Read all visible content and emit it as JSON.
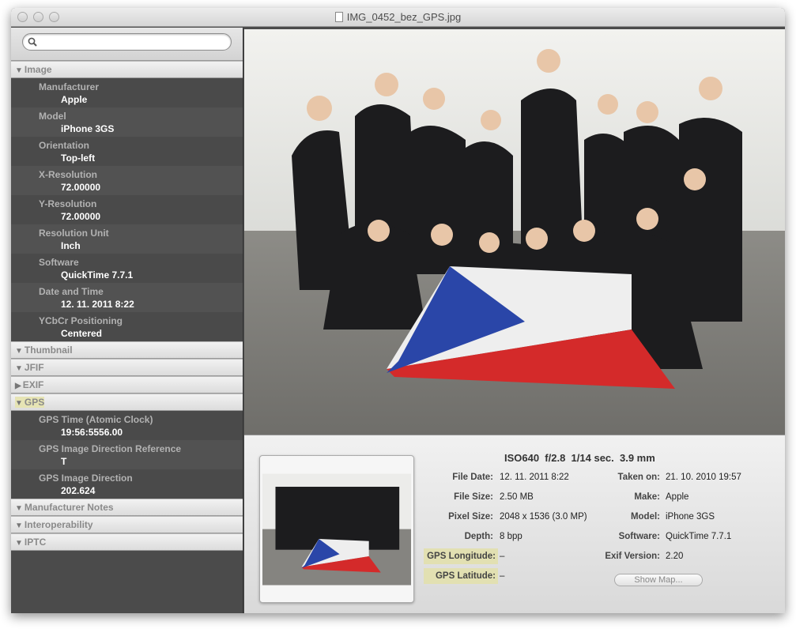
{
  "window": {
    "title": "IMG_0452_bez_GPS.jpg"
  },
  "search": {
    "placeholder": ""
  },
  "sections": [
    {
      "label": "Image",
      "expanded": true,
      "rows": [
        {
          "k": "Manufacturer",
          "v": "Apple"
        },
        {
          "k": "Model",
          "v": "iPhone 3GS"
        },
        {
          "k": "Orientation",
          "v": "Top-left"
        },
        {
          "k": "X-Resolution",
          "v": "72.00000"
        },
        {
          "k": "Y-Resolution",
          "v": "72.00000"
        },
        {
          "k": "Resolution Unit",
          "v": "Inch"
        },
        {
          "k": "Software",
          "v": "QuickTime 7.7.1"
        },
        {
          "k": "Date and Time",
          "v": "12. 11. 2011 8:22"
        },
        {
          "k": "YCbCr Positioning",
          "v": "Centered"
        }
      ]
    },
    {
      "label": "Thumbnail",
      "expanded": true,
      "rows": []
    },
    {
      "label": "JFIF",
      "expanded": true,
      "rows": []
    },
    {
      "label": "EXIF",
      "expanded": false,
      "rows": []
    },
    {
      "label": "GPS",
      "expanded": true,
      "highlight": true,
      "rows": [
        {
          "k": "GPS Time (Atomic Clock)",
          "v": "19:56:5556.00"
        },
        {
          "k": "GPS Image Direction Reference",
          "v": "T"
        },
        {
          "k": "GPS Image Direction",
          "v": "202.624"
        }
      ]
    },
    {
      "label": "Manufacturer Notes",
      "expanded": true,
      "rows": []
    },
    {
      "label": "Interoperability",
      "expanded": true,
      "rows": []
    },
    {
      "label": "IPTC",
      "expanded": true,
      "rows": []
    }
  ],
  "info": {
    "exposure": "ISO640  f/2.8  1/14 sec.  3.9 mm",
    "left": [
      {
        "k": "File Date:",
        "v": "12. 11. 2011 8:22"
      },
      {
        "k": "File Size:",
        "v": "2.50 MB"
      },
      {
        "k": "Pixel Size:",
        "v": "2048 x 1536 (3.0 MP)"
      },
      {
        "k": "Depth:",
        "v": "8 bpp"
      },
      {
        "k": "GPS Longitude:",
        "v": "–"
      },
      {
        "k": "GPS Latitude:",
        "v": "–"
      }
    ],
    "right": [
      {
        "k": "Taken  on:",
        "v": "21. 10. 2010 19:57"
      },
      {
        "k": "Make:",
        "v": "Apple"
      },
      {
        "k": "Model:",
        "v": "iPhone 3GS"
      },
      {
        "k": "Software:",
        "v": "QuickTime 7.7.1"
      },
      {
        "k": "Exif Version:",
        "v": "2.20"
      }
    ],
    "show_map": "Show Map..."
  },
  "colors": {
    "highlight": "#e2e0b2",
    "sidebar": "#4b4b4b"
  }
}
